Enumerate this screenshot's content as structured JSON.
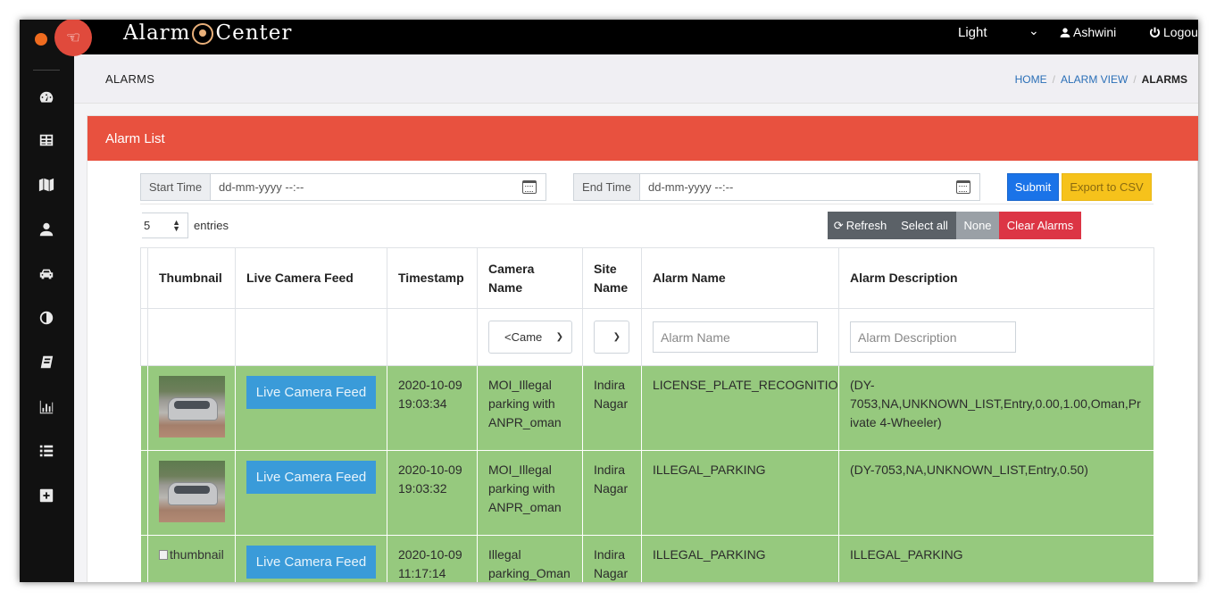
{
  "app": {
    "brand_left": "Alarm",
    "brand_right": "Center",
    "theme": "Light",
    "user": "Ashwini",
    "logout": "Logout"
  },
  "header": {
    "page_title": "ALARMS",
    "breadcrumb": [
      "HOME",
      "ALARM VIEW",
      "ALARMS"
    ]
  },
  "panel": {
    "title": "Alarm List",
    "start_label": "Start Time",
    "start_placeholder": "dd-mm-yyyy --:--",
    "end_label": "End Time",
    "end_placeholder": "dd-mm-yyyy --:--",
    "submit_label": "Submit",
    "csv_label": "Export to CSV",
    "entries_value": "5",
    "entries_label": "entries",
    "refresh_label": "Refresh",
    "select_all_label": "Select all",
    "none_label": "None",
    "clear_label": "Clear Alarms"
  },
  "table": {
    "columns": [
      "Thumbnail",
      "Live Camera Feed",
      "Timestamp",
      "Camera Name",
      "Site Name",
      "Alarm Name",
      "Alarm Description"
    ],
    "camera_filter": "<Came",
    "alarm_name_placeholder": "Alarm Name",
    "alarm_desc_placeholder": "Alarm Description",
    "rows": [
      {
        "thumbnail_alt": "",
        "live_label": "Live Camera Feed",
        "timestamp": "2020-10-09 19:03:34",
        "camera": "MOI_Illegal parking with ANPR_oman",
        "site": "Indira Nagar",
        "alarm_name": "LICENSE_PLATE_RECOGNITION",
        "description": "(DY-7053,NA,UNKNOWN_LIST,Entry,0.00,1.00,Oman,Private 4-Wheeler)"
      },
      {
        "thumbnail_alt": "",
        "live_label": "Live Camera Feed",
        "timestamp": "2020-10-09 19:03:32",
        "camera": "MOI_Illegal parking with ANPR_oman",
        "site": "Indira Nagar",
        "alarm_name": "ILLEGAL_PARKING",
        "description": "(DY-7053,NA,UNKNOWN_LIST,Entry,0.50)"
      },
      {
        "thumbnail_alt": "thumbnail",
        "live_label": "Live Camera Feed",
        "timestamp": "2020-10-09 11:17:14",
        "camera": "Illegal parking_Oman",
        "site": "Indira Nagar",
        "alarm_name": "ILLEGAL_PARKING",
        "description": "ILLEGAL_PARKING"
      }
    ]
  },
  "colors": {
    "panel_header": "#e8513f",
    "row_green": "#96c97e",
    "submit": "#1a73e8",
    "csv": "#f6c21b",
    "clear": "#dc3545",
    "refresh": "#5b6167",
    "none": "#9aa0a6"
  }
}
